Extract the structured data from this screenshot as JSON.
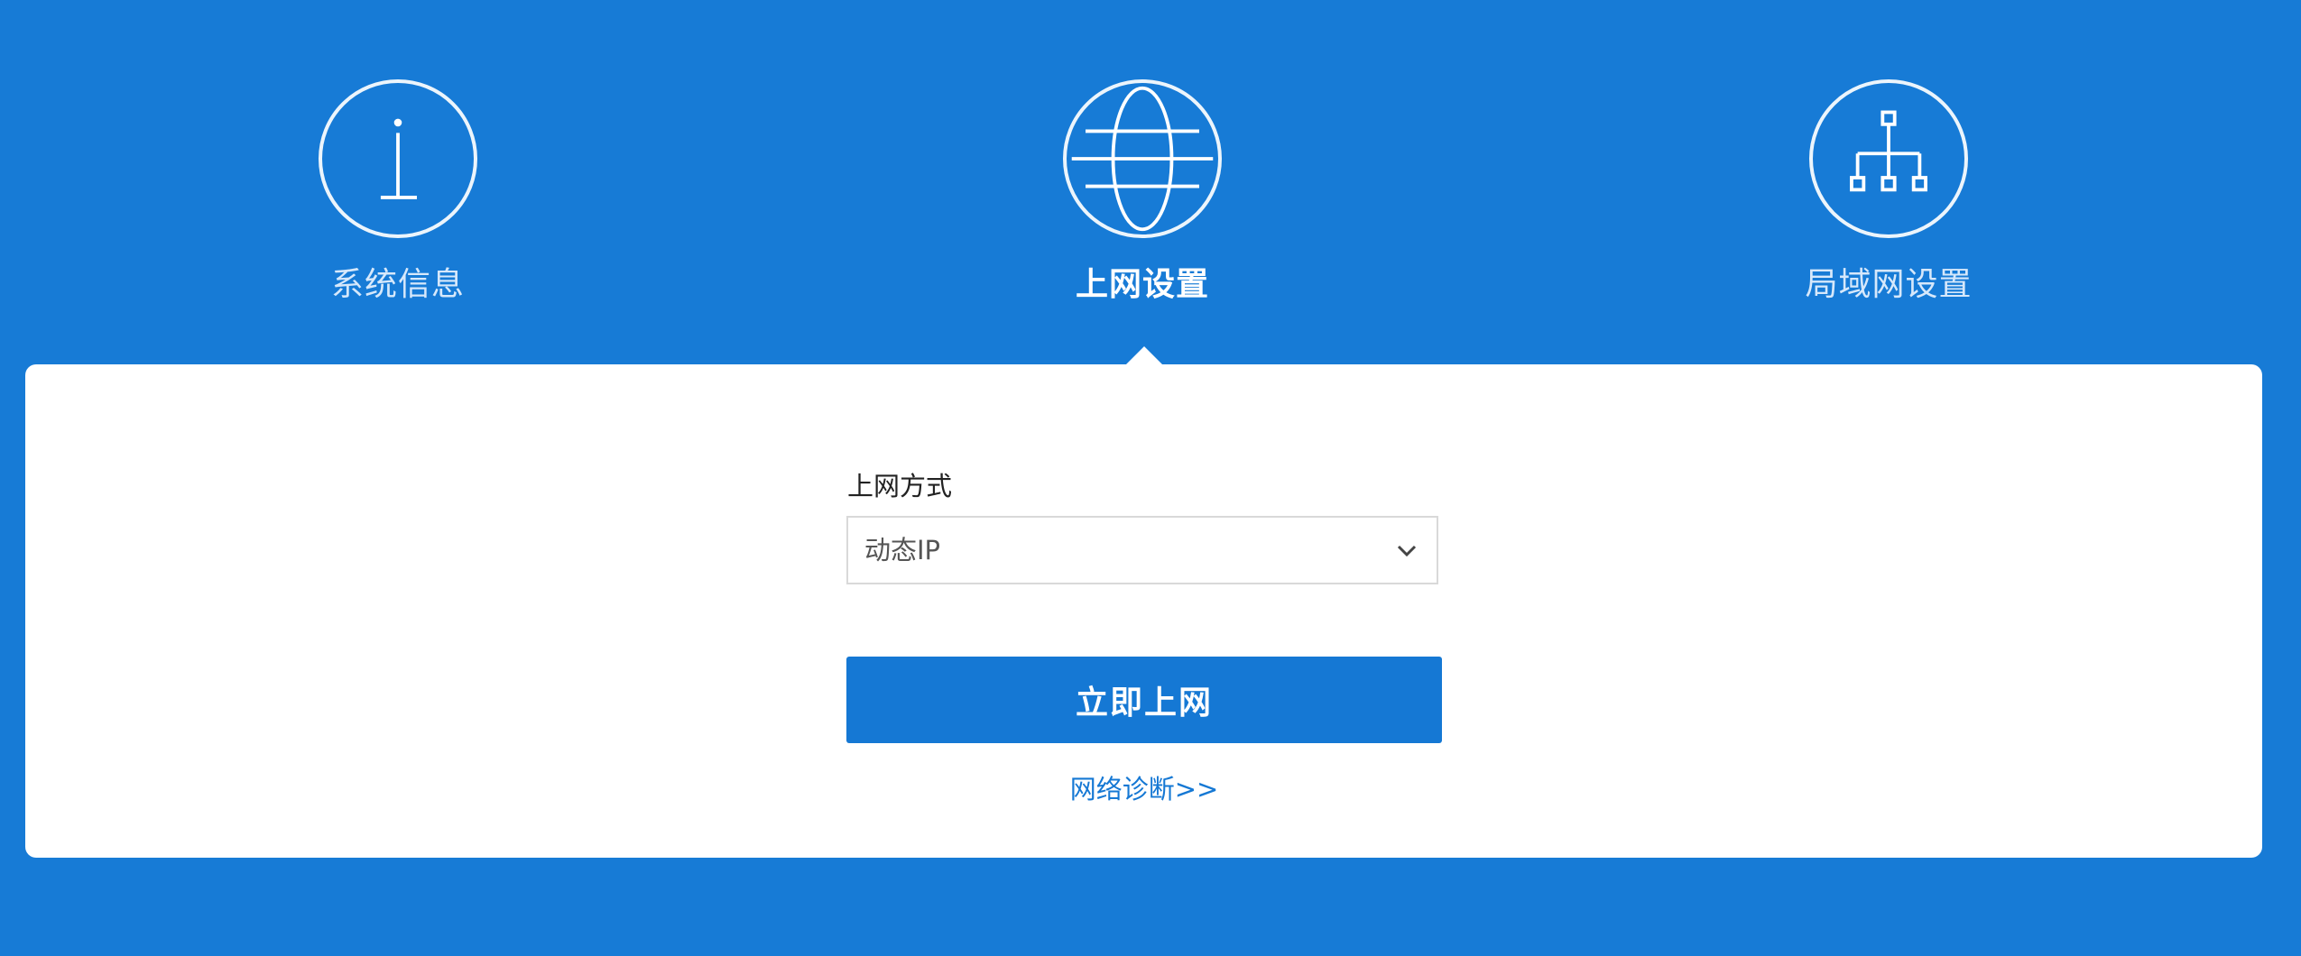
{
  "nav": {
    "items": [
      {
        "label": "系统信息",
        "icon": "info-icon",
        "active": false
      },
      {
        "label": "上网设置",
        "icon": "globe-icon",
        "active": true
      },
      {
        "label": "局域网设置",
        "icon": "network-topology-icon",
        "active": false
      }
    ]
  },
  "form": {
    "connection_type_label": "上网方式",
    "connection_type_value": "动态IP",
    "connect_button_label": "立即上网",
    "diagnose_link_label": "网络诊断>>"
  },
  "colors": {
    "background": "#177bd6",
    "accent": "#1578d4",
    "panel": "#ffffff"
  }
}
